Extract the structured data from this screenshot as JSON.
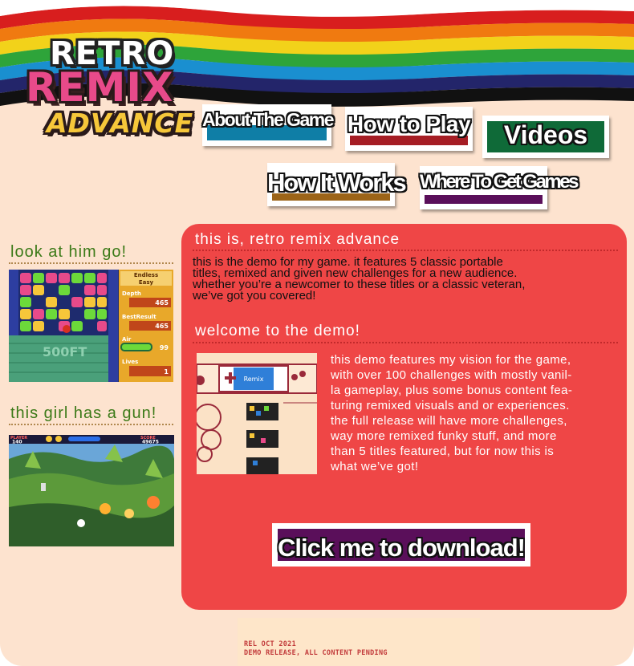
{
  "logo": {
    "line1": "RETRO",
    "line2": "REMIX",
    "line3": "ADVANCE"
  },
  "nav": [
    {
      "label": "About The Game",
      "color": "#0f7ea6"
    },
    {
      "label": "How to Play",
      "color": "#a51d24"
    },
    {
      "label": "Videos",
      "color": "#0f6a38"
    },
    {
      "label": "How It Works",
      "color": "#9c6418"
    },
    {
      "label": "Where To Get Games",
      "color": "#5a0f5a"
    }
  ],
  "sidebar": {
    "panel1": {
      "title": "look at him go!",
      "game": {
        "mode_top": "Endless",
        "mode": "Easy",
        "depth_label": "Depth",
        "depth_value": "465",
        "best_label": "BestResult",
        "best_value": "465",
        "air_label": "Air",
        "air_value": "99",
        "lives_label": "Lives",
        "lives_value": "1",
        "overlay": "500FT"
      }
    },
    "panel2": {
      "title": "this girl has a gun!",
      "game": {
        "player_label": "PLAYER",
        "player_value": "140",
        "score_label": "SCORE",
        "score_value": "49675"
      }
    }
  },
  "main": {
    "heading1": "this is, retro remix advance",
    "intro": [
      "this is the demo for my game. it features 5 classic portable",
      "titles, remixed and given new challenges for a new audience.",
      "whether you’re a newcomer to these titles or a classic veteran,",
      "we’ve got you covered!"
    ],
    "heading2": "welcome to the demo!",
    "demo_image_label": "Remix",
    "demo_text": [
      "this demo features my vision for the game,",
      "with over 100 challenges with mostly vanil-",
      "la gameplay, plus some bonus content fea-",
      "turing remixed visuals and or experiences.",
      "the full release will have more challenges,",
      "way more remixed funky stuff, and more",
      "than 5 titles featured, but for now this is",
      "what we’ve got!"
    ],
    "download_label": "Click me to download!"
  },
  "footer": {
    "line1": "REL OCT 2021",
    "line2": "DEMO RELEASE, ALL CONTENT PENDING"
  },
  "colors": {
    "background": "#fde3cf",
    "main_panel": "#ef4646",
    "accent_green": "#3c7a18",
    "download_bg": "#5a0f5a"
  }
}
